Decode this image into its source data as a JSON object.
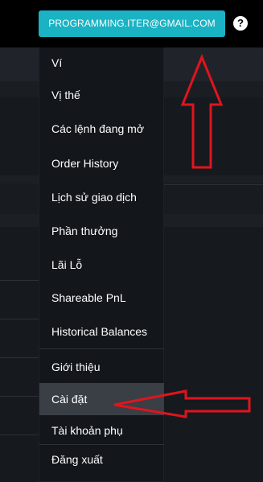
{
  "header": {
    "account_email": "PROGRAMMING.ITER@GMAIL.COM",
    "help_icon": "question-circle-icon"
  },
  "menu": {
    "items": [
      {
        "label": "Ví"
      },
      {
        "label": "Vị thế"
      },
      {
        "label": "Các lệnh đang mở"
      },
      {
        "label": "Order History"
      },
      {
        "label": "Lịch sử giao dịch"
      },
      {
        "label": "Phần thưởng"
      },
      {
        "label": "Lãi Lỗ"
      },
      {
        "label": "Shareable PnL"
      },
      {
        "label": "Historical Balances"
      },
      {
        "label": "Giới thiệu"
      },
      {
        "label": "Cài đặt",
        "active": true
      },
      {
        "label": "Tài khoản phụ"
      },
      {
        "label": "Đăng xuất"
      }
    ]
  },
  "colors": {
    "accent": "#1ab3c4",
    "annotation": "#e0141e"
  }
}
